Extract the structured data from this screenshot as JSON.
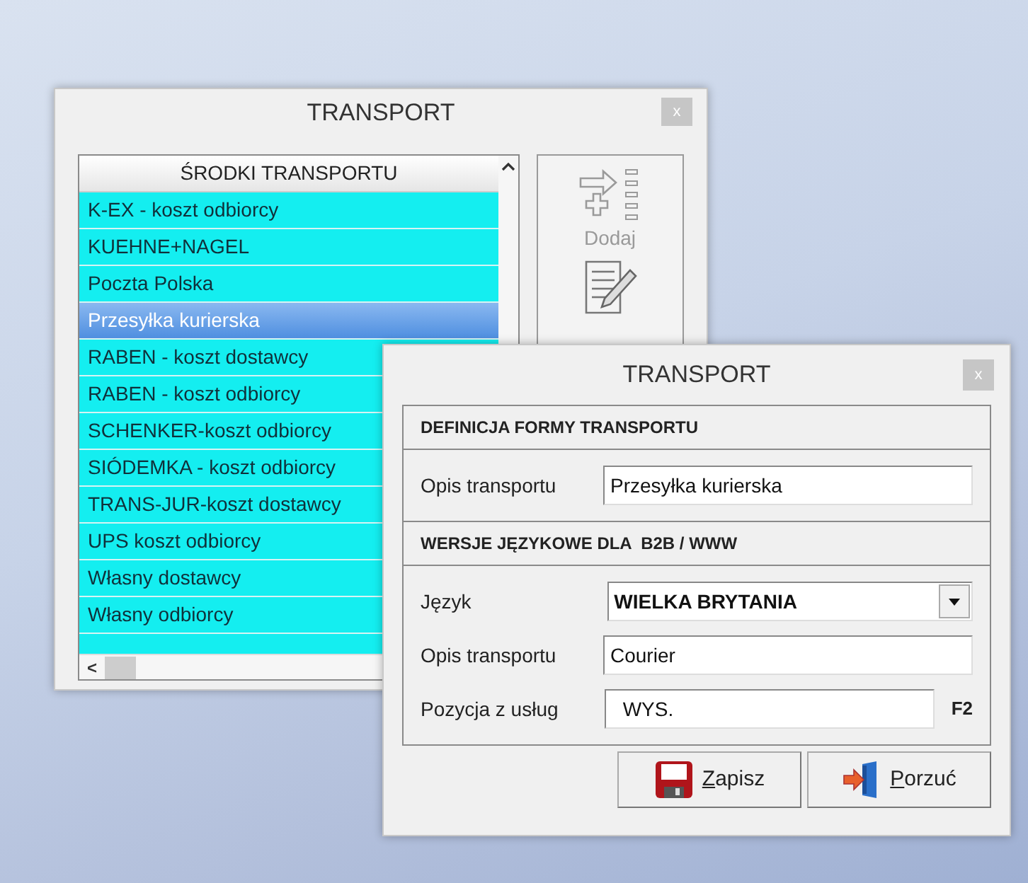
{
  "back_window": {
    "title": "TRANSPORT",
    "close": "x",
    "list": {
      "header": "ŚRODKI TRANSPORTU",
      "scroll_left": "<",
      "rows": [
        {
          "label": "K-EX - koszt odbiorcy",
          "selected": false
        },
        {
          "label": "KUEHNE+NAGEL",
          "selected": false
        },
        {
          "label": "Poczta Polska",
          "selected": false
        },
        {
          "label": "Przesyłka kurierska",
          "selected": true
        },
        {
          "label": "RABEN - koszt dostawcy",
          "selected": false
        },
        {
          "label": "RABEN - koszt odbiorcy",
          "selected": false
        },
        {
          "label": "SCHENKER-koszt odbiorcy",
          "selected": false
        },
        {
          "label": "SIÓDEMKA - koszt odbiorcy",
          "selected": false
        },
        {
          "label": "TRANS-JUR-koszt dostawcy",
          "selected": false
        },
        {
          "label": "UPS koszt odbiorcy",
          "selected": false
        },
        {
          "label": "Własny dostawcy",
          "selected": false
        },
        {
          "label": "Własny odbiorcy",
          "selected": false
        }
      ]
    },
    "add_button": {
      "label": "Dodaj",
      "disabled": true
    }
  },
  "dialog": {
    "title": "TRANSPORT",
    "close": "x",
    "sections": [
      {
        "header": "DEFINICJA FORMY TRANSPORTU",
        "fields": [
          {
            "kind": "text",
            "label": "Opis transportu",
            "value": "Przesyłka kurierska"
          }
        ]
      },
      {
        "header": "WERSJE JĘZYKOWE DLA  B2B / WWW",
        "fields": [
          {
            "kind": "combo",
            "label": "Język",
            "value": "WIELKA BRYTANIA"
          },
          {
            "kind": "text",
            "label": "Opis transportu",
            "value": "Courier"
          },
          {
            "kind": "text",
            "label": "Pozycja z usług",
            "value": "WYS.",
            "shortcut": "F2"
          }
        ]
      }
    ],
    "buttons": [
      {
        "kind": "save",
        "label": "Zapisz"
      },
      {
        "kind": "cancel",
        "label": "Porzuć"
      }
    ]
  }
}
